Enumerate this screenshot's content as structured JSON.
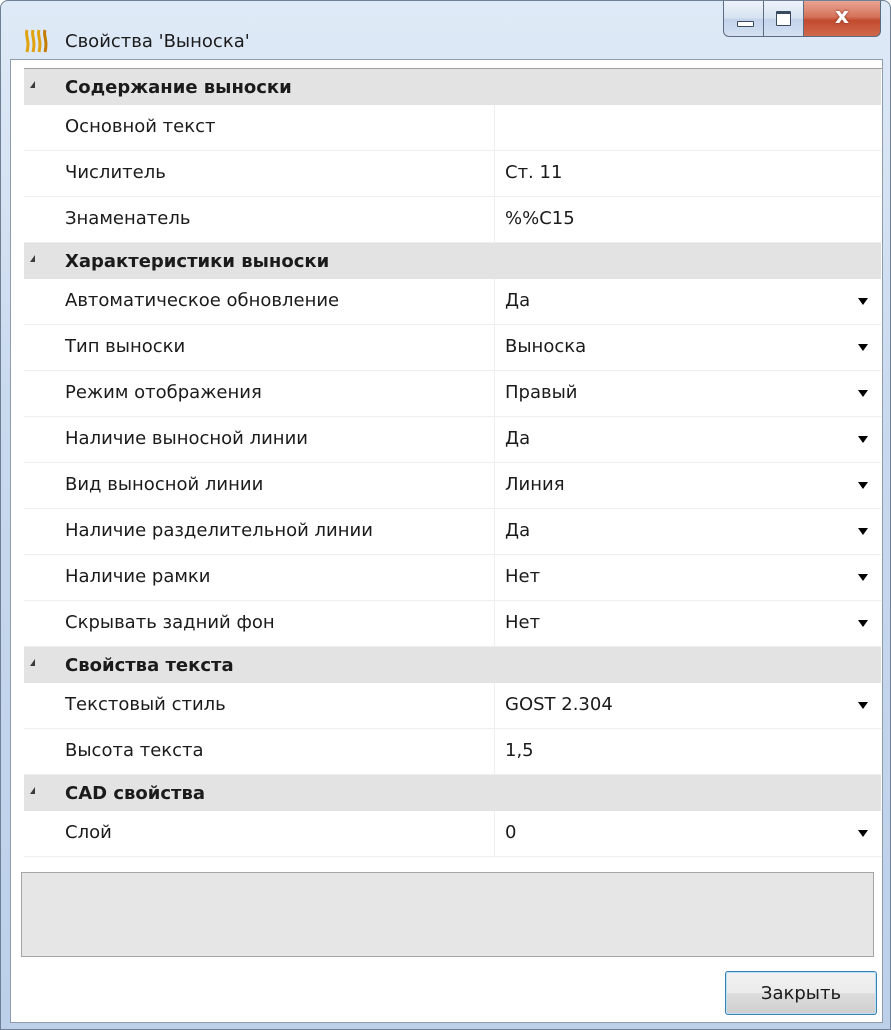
{
  "window": {
    "title": "Свойства 'Выноска'",
    "close_glyph": "x"
  },
  "categories": [
    {
      "label": "Содержание выноски",
      "rows": [
        {
          "name": "Основной текст",
          "value": "",
          "dropdown": false
        },
        {
          "name": "Числитель",
          "value": "Ст. 11",
          "dropdown": false
        },
        {
          "name": "Знаменатель",
          "value": "%%C15",
          "dropdown": false
        }
      ]
    },
    {
      "label": "Характеристики выноски",
      "rows": [
        {
          "name": "Автоматическое обновление",
          "value": "Да",
          "dropdown": true
        },
        {
          "name": "Тип выноски",
          "value": "Выноска",
          "dropdown": true
        },
        {
          "name": "Режим отображения",
          "value": "Правый",
          "dropdown": true
        },
        {
          "name": "Наличие выносной линии",
          "value": "Да",
          "dropdown": true
        },
        {
          "name": "Вид выносной линии",
          "value": "Линия",
          "dropdown": true
        },
        {
          "name": "Наличие разделительной линии",
          "value": "Да",
          "dropdown": true
        },
        {
          "name": "Наличие рамки",
          "value": "Нет",
          "dropdown": true
        },
        {
          "name": "Скрывать задний фон",
          "value": "Нет",
          "dropdown": true
        }
      ]
    },
    {
      "label": "Свойства текста",
      "rows": [
        {
          "name": "Текстовый стиль",
          "value": "GOST 2.304",
          "dropdown": true
        },
        {
          "name": "Высота текста",
          "value": "1,5",
          "dropdown": false
        }
      ]
    },
    {
      "label": "CAD свойства",
      "rows": [
        {
          "name": "Слой",
          "value": "0",
          "dropdown": true
        }
      ]
    }
  ],
  "footer": {
    "close_button_label": "Закрыть"
  },
  "colors": {
    "app_icon": "#e0a30f",
    "category_bg": "#e3e3e3",
    "close_caption_btn": "#c24b2f"
  }
}
